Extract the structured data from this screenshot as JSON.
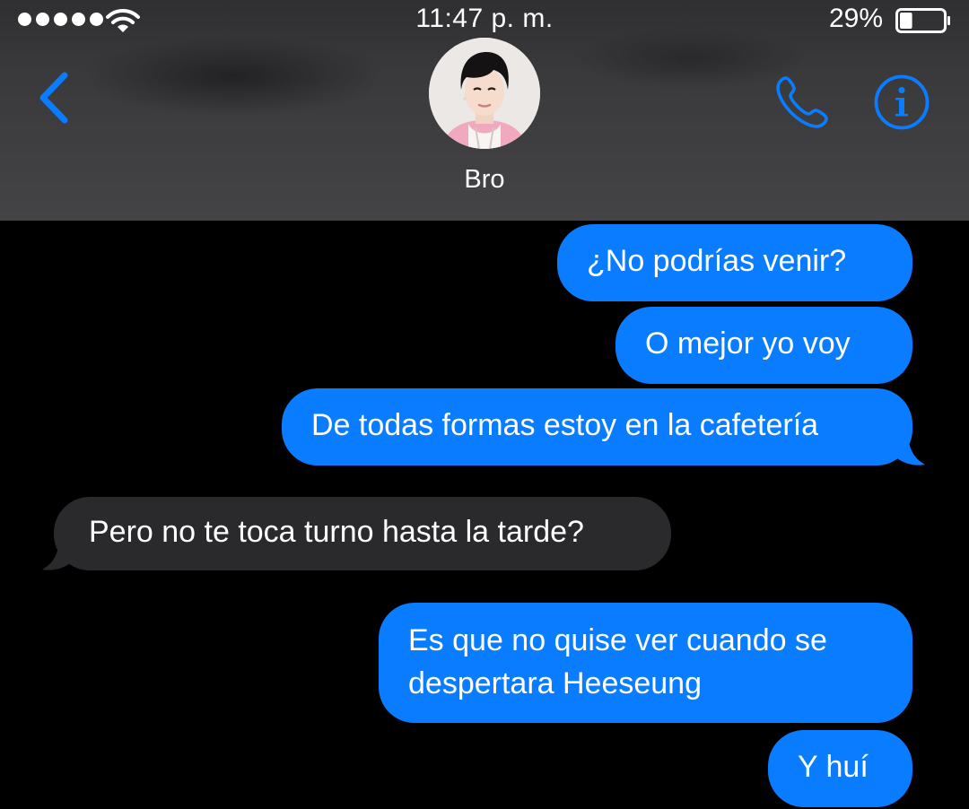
{
  "status_bar": {
    "time": "11:47 p. m.",
    "battery": "29%",
    "signal_icon": "signal-dots-icon",
    "wifi_icon": "wifi-icon",
    "battery_icon": "battery-icon",
    "battery_level": 0.29
  },
  "nav": {
    "back_icon": "chevron-left-icon",
    "call_icon": "phone-icon",
    "info_icon": "info-icon",
    "contact_name": "Bro",
    "accent": "#0a7cff"
  },
  "colors": {
    "sent_bubble": "#0a7cff",
    "received_bubble": "#2a292c",
    "background": "#000000"
  },
  "messages": [
    {
      "direction": "sent",
      "text": "¿No podrías venir?"
    },
    {
      "direction": "sent",
      "text": "O mejor yo voy"
    },
    {
      "direction": "sent",
      "text": "De todas formas estoy en la cafetería"
    },
    {
      "direction": "received",
      "text": "Pero no te toca turno hasta la tarde?"
    },
    {
      "direction": "sent",
      "lines": [
        "Es que no quise ver cuando se",
        "despertara Heeseung"
      ]
    },
    {
      "direction": "sent",
      "text": "Y huí"
    }
  ]
}
